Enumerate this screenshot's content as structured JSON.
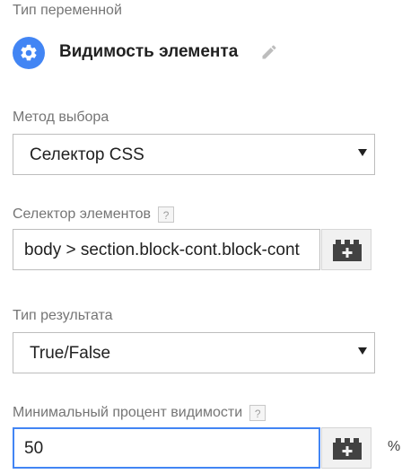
{
  "variable_type": {
    "section_label": "Тип переменной",
    "name": "Видимость элемента",
    "icon": "gear-icon",
    "icon_color": "#4285f4"
  },
  "selection_method": {
    "label": "Метод выбора",
    "selected": "Селектор CSS"
  },
  "element_selector": {
    "label": "Селектор элементов",
    "help": "?",
    "value": "body > section.block-cont.block-cont"
  },
  "result_type": {
    "label": "Тип результата",
    "selected": "True/False"
  },
  "min_percent": {
    "label": "Минимальный процент видимости",
    "help": "?",
    "value": "50",
    "unit": "%"
  },
  "colors": {
    "accent": "#4285f4",
    "label": "#757575",
    "border": "#bdbdbd"
  }
}
